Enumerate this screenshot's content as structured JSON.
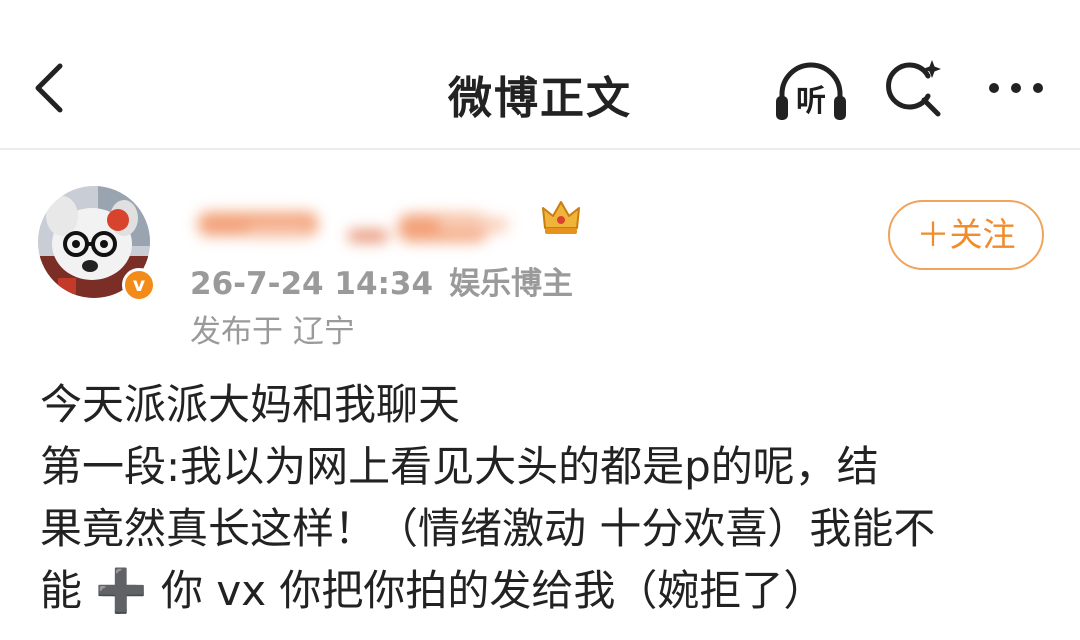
{
  "nav": {
    "title": "微博正文",
    "back_icon": "chevron-left-icon",
    "listen_label": "听",
    "search_icon": "search-sparkle-icon",
    "more_icon": "more-dots-icon"
  },
  "post": {
    "author": {
      "avatar_icon": "avatar-image",
      "verified_badge": "v",
      "badge_icon": "crown-icon",
      "username_obscured": true
    },
    "timestamp": "26-7-24 14:34",
    "category": "娱乐博主",
    "location": "发布于 辽宁",
    "follow_label": "＋关注",
    "content_lines": [
      "今天派派大妈和我聊天",
      "第一段:我以为网上看见大头的都是p的呢，结",
      "果竟然真长这样！（情绪激动 十分欢喜）我能不",
      "能 ➕ 你 vx 你把你拍的发给我（婉拒了）"
    ]
  },
  "colors": {
    "accent_orange": "#f08c2c",
    "meta_gray": "#9a9a9a",
    "text_dark": "#222222"
  }
}
